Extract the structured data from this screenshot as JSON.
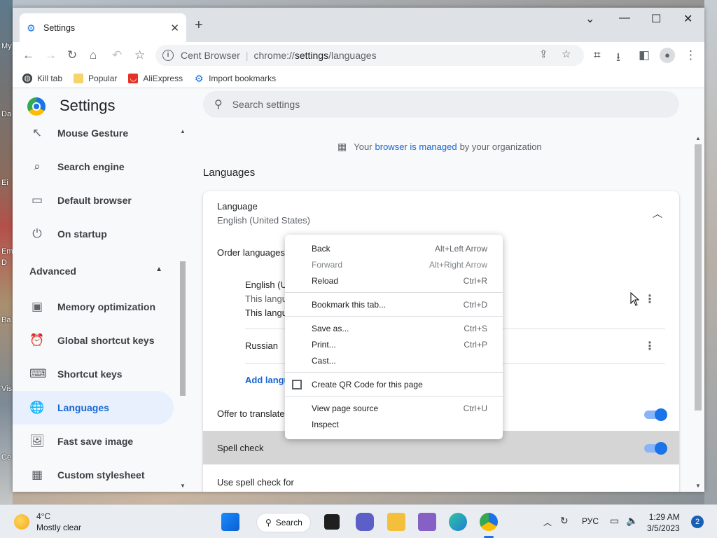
{
  "desktop": {
    "labels": [
      "My",
      "Da",
      "Ei",
      "Em",
      "D",
      "Ba",
      "Vis",
      "Ce"
    ]
  },
  "tab": {
    "title": "Settings"
  },
  "omnibox": {
    "site": "Cent Browser",
    "url_prefix": "chrome://",
    "url_main": "settings",
    "url_suffix": "/languages"
  },
  "bookmarks": [
    "Kill tab",
    "Popular",
    "AliExpress",
    "Import bookmarks"
  ],
  "header": {
    "title": "Settings",
    "search_placeholder": "Search settings"
  },
  "sidebar": {
    "items": [
      {
        "label": "Mouse Gesture",
        "icon": "↖"
      },
      {
        "label": "Search engine",
        "icon": "⌕"
      },
      {
        "label": "Default browser",
        "icon": "▭"
      },
      {
        "label": "On startup",
        "icon": "⏻"
      },
      {
        "label": "Memory optimization",
        "icon": "▣"
      },
      {
        "label": "Global shortcut keys",
        "icon": "⏰"
      },
      {
        "label": "Shortcut keys",
        "icon": "⌨"
      },
      {
        "label": "Languages",
        "icon": "🌐"
      },
      {
        "label": "Fast save image",
        "icon": "🖼"
      },
      {
        "label": "Custom stylesheet",
        "icon": "▦"
      }
    ],
    "advanced": "Advanced"
  },
  "main": {
    "managed_pre": "Your",
    "managed_link": "browser is managed",
    "managed_post": "by your organization",
    "section_title": "Languages",
    "language_label": "Language",
    "language_value": "English (United States)",
    "order_languages": "Order languages",
    "lang1_name": "English (U",
    "lang1_desc1": "This langu",
    "lang1_desc2": "This langu",
    "lang2_name": "Russian",
    "add_languages": "Add langu",
    "offer_translate": "Offer to translate",
    "spell_check": "Spell check",
    "use_spell_check": "Use spell check for"
  },
  "context_menu": {
    "items": [
      {
        "label": "Back",
        "shortcut": "Alt+Left Arrow"
      },
      {
        "label": "Forward",
        "shortcut": "Alt+Right Arrow"
      },
      {
        "label": "Reload",
        "shortcut": "Ctrl+R"
      },
      {
        "label": "Bookmark this tab...",
        "shortcut": "Ctrl+D"
      },
      {
        "label": "Save as...",
        "shortcut": "Ctrl+S"
      },
      {
        "label": "Print...",
        "shortcut": "Ctrl+P"
      },
      {
        "label": "Cast...",
        "shortcut": ""
      },
      {
        "label": "Create QR Code for this page",
        "shortcut": ""
      },
      {
        "label": "View page source",
        "shortcut": "Ctrl+U"
      },
      {
        "label": "Inspect",
        "shortcut": ""
      }
    ]
  },
  "taskbar": {
    "temp": "4°C",
    "weather": "Mostly clear",
    "search": "Search",
    "lang": "РУС",
    "time": "1:29 AM",
    "date": "3/5/2023",
    "notifications": "2"
  },
  "colors": {
    "accent": "#1a73e8",
    "active_nav_bg": "#e8f0fe",
    "page_bg": "#f8f9fa"
  }
}
